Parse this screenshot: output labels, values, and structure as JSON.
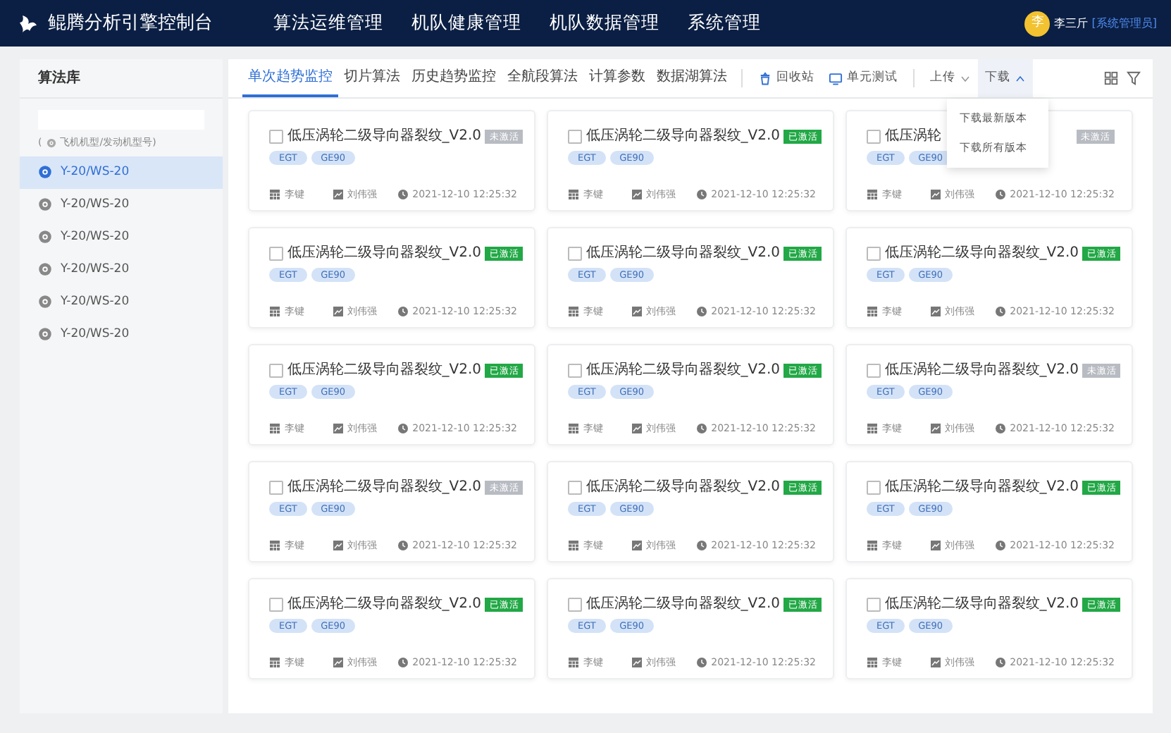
{
  "header": {
    "app_title": "鲲腾分析引擎控制台",
    "menu": [
      {
        "label": "算法运维管理"
      },
      {
        "label": "机队健康管理"
      },
      {
        "label": "机队数据管理"
      },
      {
        "label": "系统管理"
      }
    ],
    "user": {
      "avatar": "李",
      "name": "李三斤",
      "role": "[系统管理员]"
    }
  },
  "sidebar": {
    "title": "算法库",
    "hint_open": "(",
    "hint": "飞机机型/发动机型号)",
    "items": [
      {
        "label": "Y-20/WS-20",
        "selected": true
      },
      {
        "label": "Y-20/WS-20",
        "selected": false
      },
      {
        "label": "Y-20/WS-20",
        "selected": false
      },
      {
        "label": "Y-20/WS-20",
        "selected": false
      },
      {
        "label": "Y-20/WS-20",
        "selected": false
      },
      {
        "label": "Y-20/WS-20",
        "selected": false
      }
    ]
  },
  "tabs": [
    {
      "label": "单次趋势监控",
      "selected": true
    },
    {
      "label": "切片算法",
      "selected": false
    },
    {
      "label": "历史趋势监控",
      "selected": false
    },
    {
      "label": "全航段算法",
      "selected": false
    },
    {
      "label": "计算参数",
      "selected": false
    },
    {
      "label": "数据湖算法",
      "selected": false
    }
  ],
  "tools": [
    {
      "kind": "recycle",
      "label": "回收站"
    },
    {
      "kind": "test",
      "label": "单元测试"
    }
  ],
  "dropdowns": [
    {
      "label": "上传",
      "expanded": false
    },
    {
      "label": "下载",
      "expanded": true,
      "options": [
        "下载最新版本",
        "下载所有版本"
      ]
    }
  ],
  "cards": [
    {
      "title": "低压涡轮二级导向器裂纹_V2.0",
      "checked": false,
      "status": "未激活",
      "active": false,
      "tags": [
        "EGT",
        "GE90"
      ],
      "owner": "李键",
      "reviewer": "刘伟强",
      "time": "2021-12-10 12:25:32"
    },
    {
      "title": "低压涡轮二级导向器裂纹_V2.0",
      "checked": false,
      "status": "已激活",
      "active": true,
      "tags": [
        "EGT",
        "GE90"
      ],
      "owner": "李键",
      "reviewer": "刘伟强",
      "time": "2021-12-10 12:25:32"
    },
    {
      "title": "低压涡轮",
      "checked": false,
      "status": "未激活",
      "active": false,
      "tags": [
        "EGT",
        "GE90"
      ],
      "owner": "李键",
      "reviewer": "刘伟强",
      "time": "2021-12-10 12:25:32"
    },
    {
      "title": "低压涡轮二级导向器裂纹_V2.0",
      "checked": false,
      "status": "已激活",
      "active": true,
      "tags": [
        "EGT",
        "GE90"
      ],
      "owner": "李键",
      "reviewer": "刘伟强",
      "time": "2021-12-10 12:25:32"
    },
    {
      "title": "低压涡轮二级导向器裂纹_V2.0",
      "checked": false,
      "status": "已激活",
      "active": true,
      "tags": [
        "EGT",
        "GE90"
      ],
      "owner": "李键",
      "reviewer": "刘伟强",
      "time": "2021-12-10 12:25:32"
    },
    {
      "title": "低压涡轮二级导向器裂纹_V2.0",
      "checked": false,
      "status": "已激活",
      "active": true,
      "tags": [
        "EGT",
        "GE90"
      ],
      "owner": "李键",
      "reviewer": "刘伟强",
      "time": "2021-12-10 12:25:32"
    },
    {
      "title": "低压涡轮二级导向器裂纹_V2.0",
      "checked": false,
      "status": "已激活",
      "active": true,
      "tags": [
        "EGT",
        "GE90"
      ],
      "owner": "李键",
      "reviewer": "刘伟强",
      "time": "2021-12-10 12:25:32"
    },
    {
      "title": "低压涡轮二级导向器裂纹_V2.0",
      "checked": false,
      "status": "已激活",
      "active": true,
      "tags": [
        "EGT",
        "GE90"
      ],
      "owner": "李键",
      "reviewer": "刘伟强",
      "time": "2021-12-10 12:25:32"
    },
    {
      "title": "低压涡轮二级导向器裂纹_V2.0",
      "checked": false,
      "status": "未激活",
      "active": false,
      "tags": [
        "EGT",
        "GE90"
      ],
      "owner": "李键",
      "reviewer": "刘伟强",
      "time": "2021-12-10 12:25:32"
    },
    {
      "title": "低压涡轮二级导向器裂纹_V2.0",
      "checked": false,
      "status": "未激活",
      "active": false,
      "tags": [
        "EGT",
        "GE90"
      ],
      "owner": "李键",
      "reviewer": "刘伟强",
      "time": "2021-12-10 12:25:32"
    },
    {
      "title": "低压涡轮二级导向器裂纹_V2.0",
      "checked": false,
      "status": "已激活",
      "active": true,
      "tags": [
        "EGT",
        "GE90"
      ],
      "owner": "李键",
      "reviewer": "刘伟强",
      "time": "2021-12-10 12:25:32"
    },
    {
      "title": "低压涡轮二级导向器裂纹_V2.0",
      "checked": false,
      "status": "已激活",
      "active": true,
      "tags": [
        "EGT",
        "GE90"
      ],
      "owner": "李键",
      "reviewer": "刘伟强",
      "time": "2021-12-10 12:25:32"
    },
    {
      "title": "低压涡轮二级导向器裂纹_V2.0",
      "checked": false,
      "status": "已激活",
      "active": true,
      "tags": [
        "EGT",
        "GE90"
      ],
      "owner": "李键",
      "reviewer": "刘伟强",
      "time": "2021-12-10 12:25:32"
    },
    {
      "title": "低压涡轮二级导向器裂纹_V2.0",
      "checked": false,
      "status": "已激活",
      "active": true,
      "tags": [
        "EGT",
        "GE90"
      ],
      "owner": "李键",
      "reviewer": "刘伟强",
      "time": "2021-12-10 12:25:32"
    },
    {
      "title": "低压涡轮二级导向器裂纹_V2.0",
      "checked": false,
      "status": "已激活",
      "active": true,
      "tags": [
        "EGT",
        "GE90"
      ],
      "owner": "李键",
      "reviewer": "刘伟强",
      "time": "2021-12-10 12:25:32"
    }
  ]
}
